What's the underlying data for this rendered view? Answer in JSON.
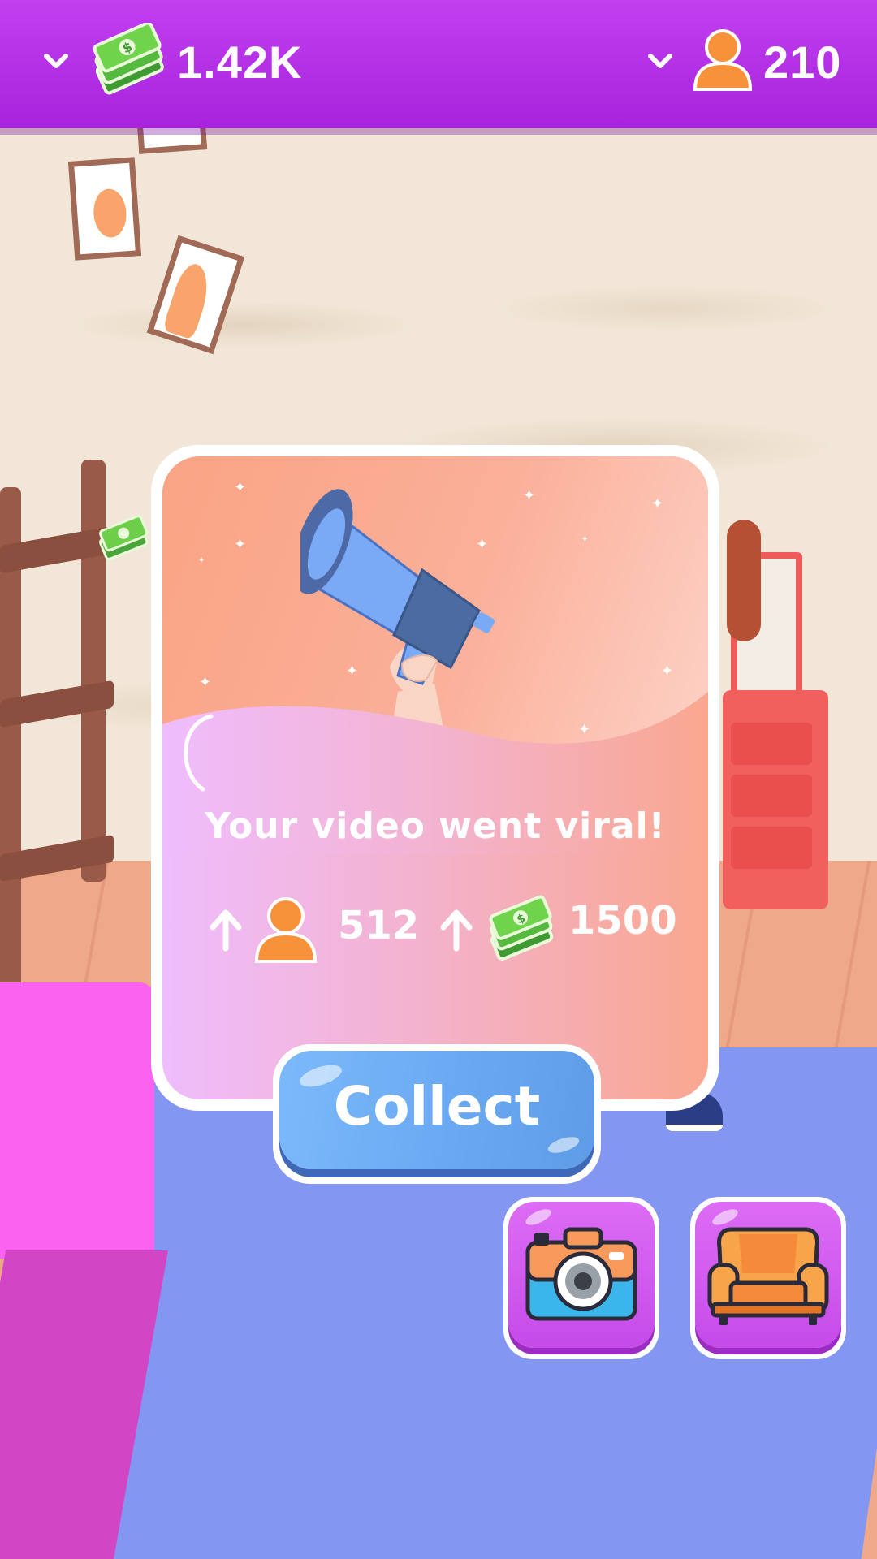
{
  "hud": {
    "cash_value": "1.42K",
    "followers_value": "210",
    "cash_icon": "cash-stack-icon",
    "followers_icon": "person-icon",
    "dropdown_icon": "chevron-down-icon"
  },
  "popup": {
    "headline": "Your video went viral!",
    "illustration_icon": "megaphone-icon",
    "rewards": {
      "followers_gain": "512",
      "cash_gain": "1500",
      "increase_icon": "arrow-up-icon"
    },
    "collect_label": "Collect"
  },
  "actions": [
    {
      "name": "camera",
      "icon": "camera-icon"
    },
    {
      "name": "furniture",
      "icon": "armchair-icon"
    }
  ],
  "colors": {
    "topbar": "#b330e6",
    "collect_button": "#6aa9f2",
    "action_button": "#d25ef0",
    "rug": "#8396f1",
    "bed": "#fb62ef"
  }
}
